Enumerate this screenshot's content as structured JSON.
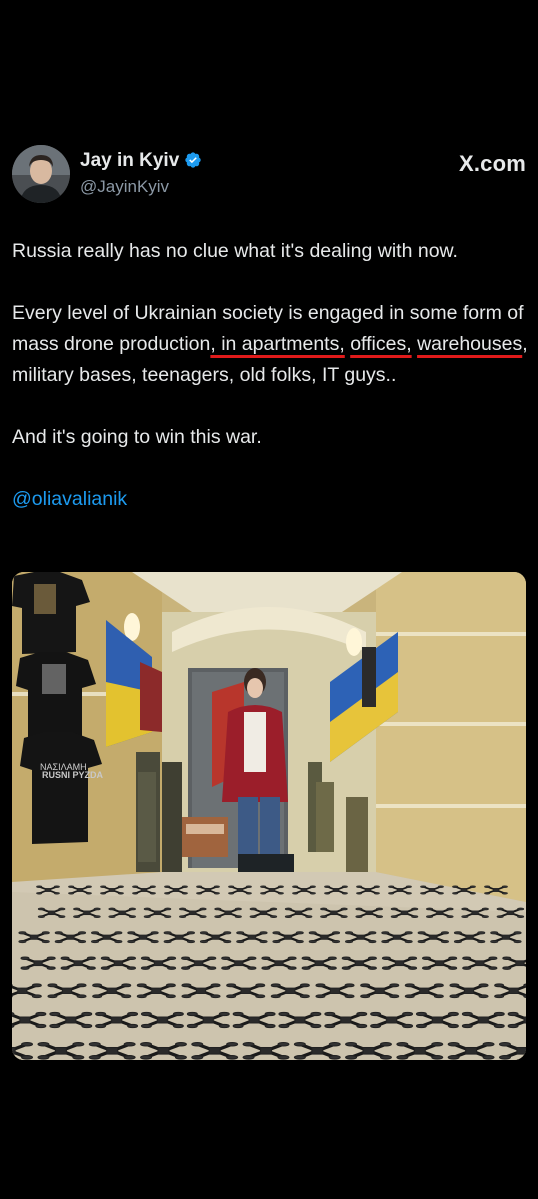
{
  "author": {
    "display_name": "Jay in Kyiv",
    "handle": "@JayinKyiv",
    "verified": true,
    "avatar_icon": "profile-photo"
  },
  "brand": {
    "label": "X.com"
  },
  "tweet": {
    "line1": "Russia really has no clue what it's dealing with now.",
    "para2": {
      "part_a": "Every level of Ukrainian society is engaged in some form of mass drone production",
      "part_b": ", in apartments,",
      "part_c": " ",
      "part_d": "offices,",
      "part_e": " ",
      "part_f": "warehouses",
      "part_g": ", military bases, teenagers, old folks, IT guys.."
    },
    "line3": "And it's going to win this war.",
    "mention": "@oliavalianik"
  },
  "media": {
    "description_icon": "photo-image",
    "shirt1_text": "",
    "shirt2_text": "ΝΑΣΙΛΑΜΗ",
    "shirt3_text": "RUSNI PYZDA"
  },
  "colors": {
    "background": "#000000",
    "text": "#e7e9ea",
    "secondary": "#8b98a5",
    "link": "#1d9bf0",
    "verified": "#1d9bf0",
    "underline_markup": "#e01a1a"
  }
}
